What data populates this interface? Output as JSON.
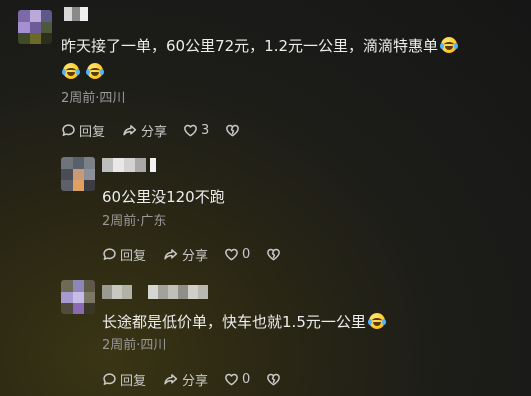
{
  "comments": [
    {
      "text": "昨天接了一单，60公里72元，1.2元一公里，滴滴特惠单",
      "emojis_inline": 1,
      "emojis_next_line": 2,
      "meta": "2周前·四川",
      "reply_label": "回复",
      "share_label": "分享",
      "like_count": "3"
    },
    {
      "text": "60公里没120不跑",
      "meta": "2周前·广东",
      "reply_label": "回复",
      "share_label": "分享",
      "like_count": "0"
    },
    {
      "text": "长途都是低价单，快车也就1.5元一公里",
      "emojis_inline": 1,
      "meta": "2周前·四川",
      "reply_label": "回复",
      "share_label": "分享",
      "like_count": "0"
    }
  ],
  "colors": {
    "text": "#ededed",
    "meta": "#9a9a9a",
    "action": "#c9c9c9"
  },
  "icons": [
    "chat-bubble-icon",
    "share-arrow-icon",
    "heart-icon",
    "broken-heart-icon",
    "laughing-tears-emoji-icon"
  ]
}
